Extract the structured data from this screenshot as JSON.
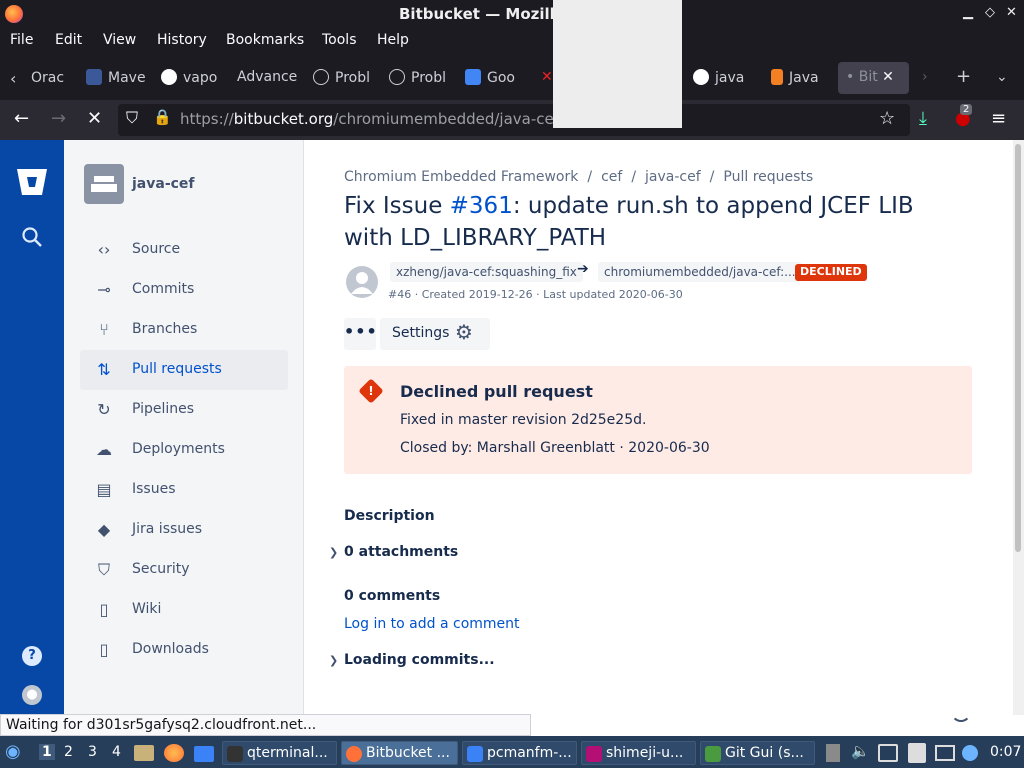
{
  "window": {
    "title": "Bitbucket — Mozilla Firefox"
  },
  "menu": [
    "File",
    "Edit",
    "View",
    "History",
    "Bookmarks",
    "Tools",
    "Help"
  ],
  "tabs": [
    {
      "label": "Orac",
      "color": "#c74634"
    },
    {
      "label": "Mave",
      "color": "#3b5998"
    },
    {
      "label": "vapo",
      "color": "#ffffff"
    },
    {
      "label": "Advance",
      "color": "#1c1b22"
    },
    {
      "label": "Probl",
      "color": "#1c1b22"
    },
    {
      "label": "Probl",
      "color": "#1c1b22"
    },
    {
      "label": "Goo",
      "color": "#4285f4"
    },
    {
      "label": "java",
      "color": "#ffffff"
    },
    {
      "label": "Java",
      "color": "#f48024"
    },
    {
      "label": "Bit",
      "color": "#8f8f9d"
    }
  ],
  "urlbar": {
    "scheme": "https://",
    "host": "bitbucket.org",
    "path": "/chromiumembedded/java-cef/pu",
    "downloads_badge": "2"
  },
  "sidebar": {
    "repo_name": "java-cef",
    "items": [
      {
        "label": "Source",
        "icon": "source-icon",
        "glyph": "‹›"
      },
      {
        "label": "Commits",
        "icon": "commits-icon",
        "glyph": "⊸"
      },
      {
        "label": "Branches",
        "icon": "branches-icon",
        "glyph": "⑂"
      },
      {
        "label": "Pull requests",
        "icon": "pull-requests-icon",
        "glyph": "⇅"
      },
      {
        "label": "Pipelines",
        "icon": "pipelines-icon",
        "glyph": "↻"
      },
      {
        "label": "Deployments",
        "icon": "deployments-icon",
        "glyph": "☁"
      },
      {
        "label": "Issues",
        "icon": "issues-icon",
        "glyph": "▤"
      },
      {
        "label": "Jira issues",
        "icon": "jira-icon",
        "glyph": "◆"
      },
      {
        "label": "Security",
        "icon": "security-icon",
        "glyph": "⛉"
      },
      {
        "label": "Wiki",
        "icon": "wiki-icon",
        "glyph": "▯"
      },
      {
        "label": "Downloads",
        "icon": "downloads-icon",
        "glyph": "▯"
      }
    ]
  },
  "breadcrumbs": [
    "Chromium Embedded Framework",
    "cef",
    "java-cef",
    "Pull requests"
  ],
  "pr": {
    "title_prefix": "Fix Issue ",
    "issue_link": "#361",
    "title_suffix": ": update run.sh to append JCEF LIB with LD_LIBRARY_PATH",
    "source_branch": "xzheng/java-cef:squashing_fix",
    "target_branch": "chromiumembedded/java-cef:...",
    "status": "DECLINED",
    "meta": "#46 · Created 2019-12-26 · Last updated 2020-06-30",
    "settings_label": "Settings"
  },
  "banner": {
    "heading": "Declined pull request",
    "line1": "Fixed in master revision 2d25e25d.",
    "line2": "Closed by: Marshall Greenblatt  ·  2020-06-30"
  },
  "content": {
    "description": "Description",
    "attachments": "0 attachments",
    "comments": "0 comments",
    "login_link": "Log in to add a comment",
    "loading": "Loading commits..."
  },
  "status_text": "Waiting for d301sr5gafysq2.cloudfront.net...",
  "taskbar": {
    "workspaces": [
      "1",
      "2",
      "3",
      "4"
    ],
    "windows": [
      {
        "label": "qterminal...",
        "color": "#333"
      },
      {
        "label": "Bitbucket ...",
        "color": "#ff7139"
      },
      {
        "label": "pcmanfm-...",
        "color": "#3b82f6"
      },
      {
        "label": "shimeji-u...",
        "color": "#b40f75"
      },
      {
        "label": "Git Gui (s...",
        "color": "#4a9b3f"
      }
    ],
    "clock": "0:07"
  },
  "colors": {
    "nav_blue": "#0747a6",
    "link": "#0052cc",
    "declined": "#de350b",
    "banner_bg": "#ffebe6"
  }
}
